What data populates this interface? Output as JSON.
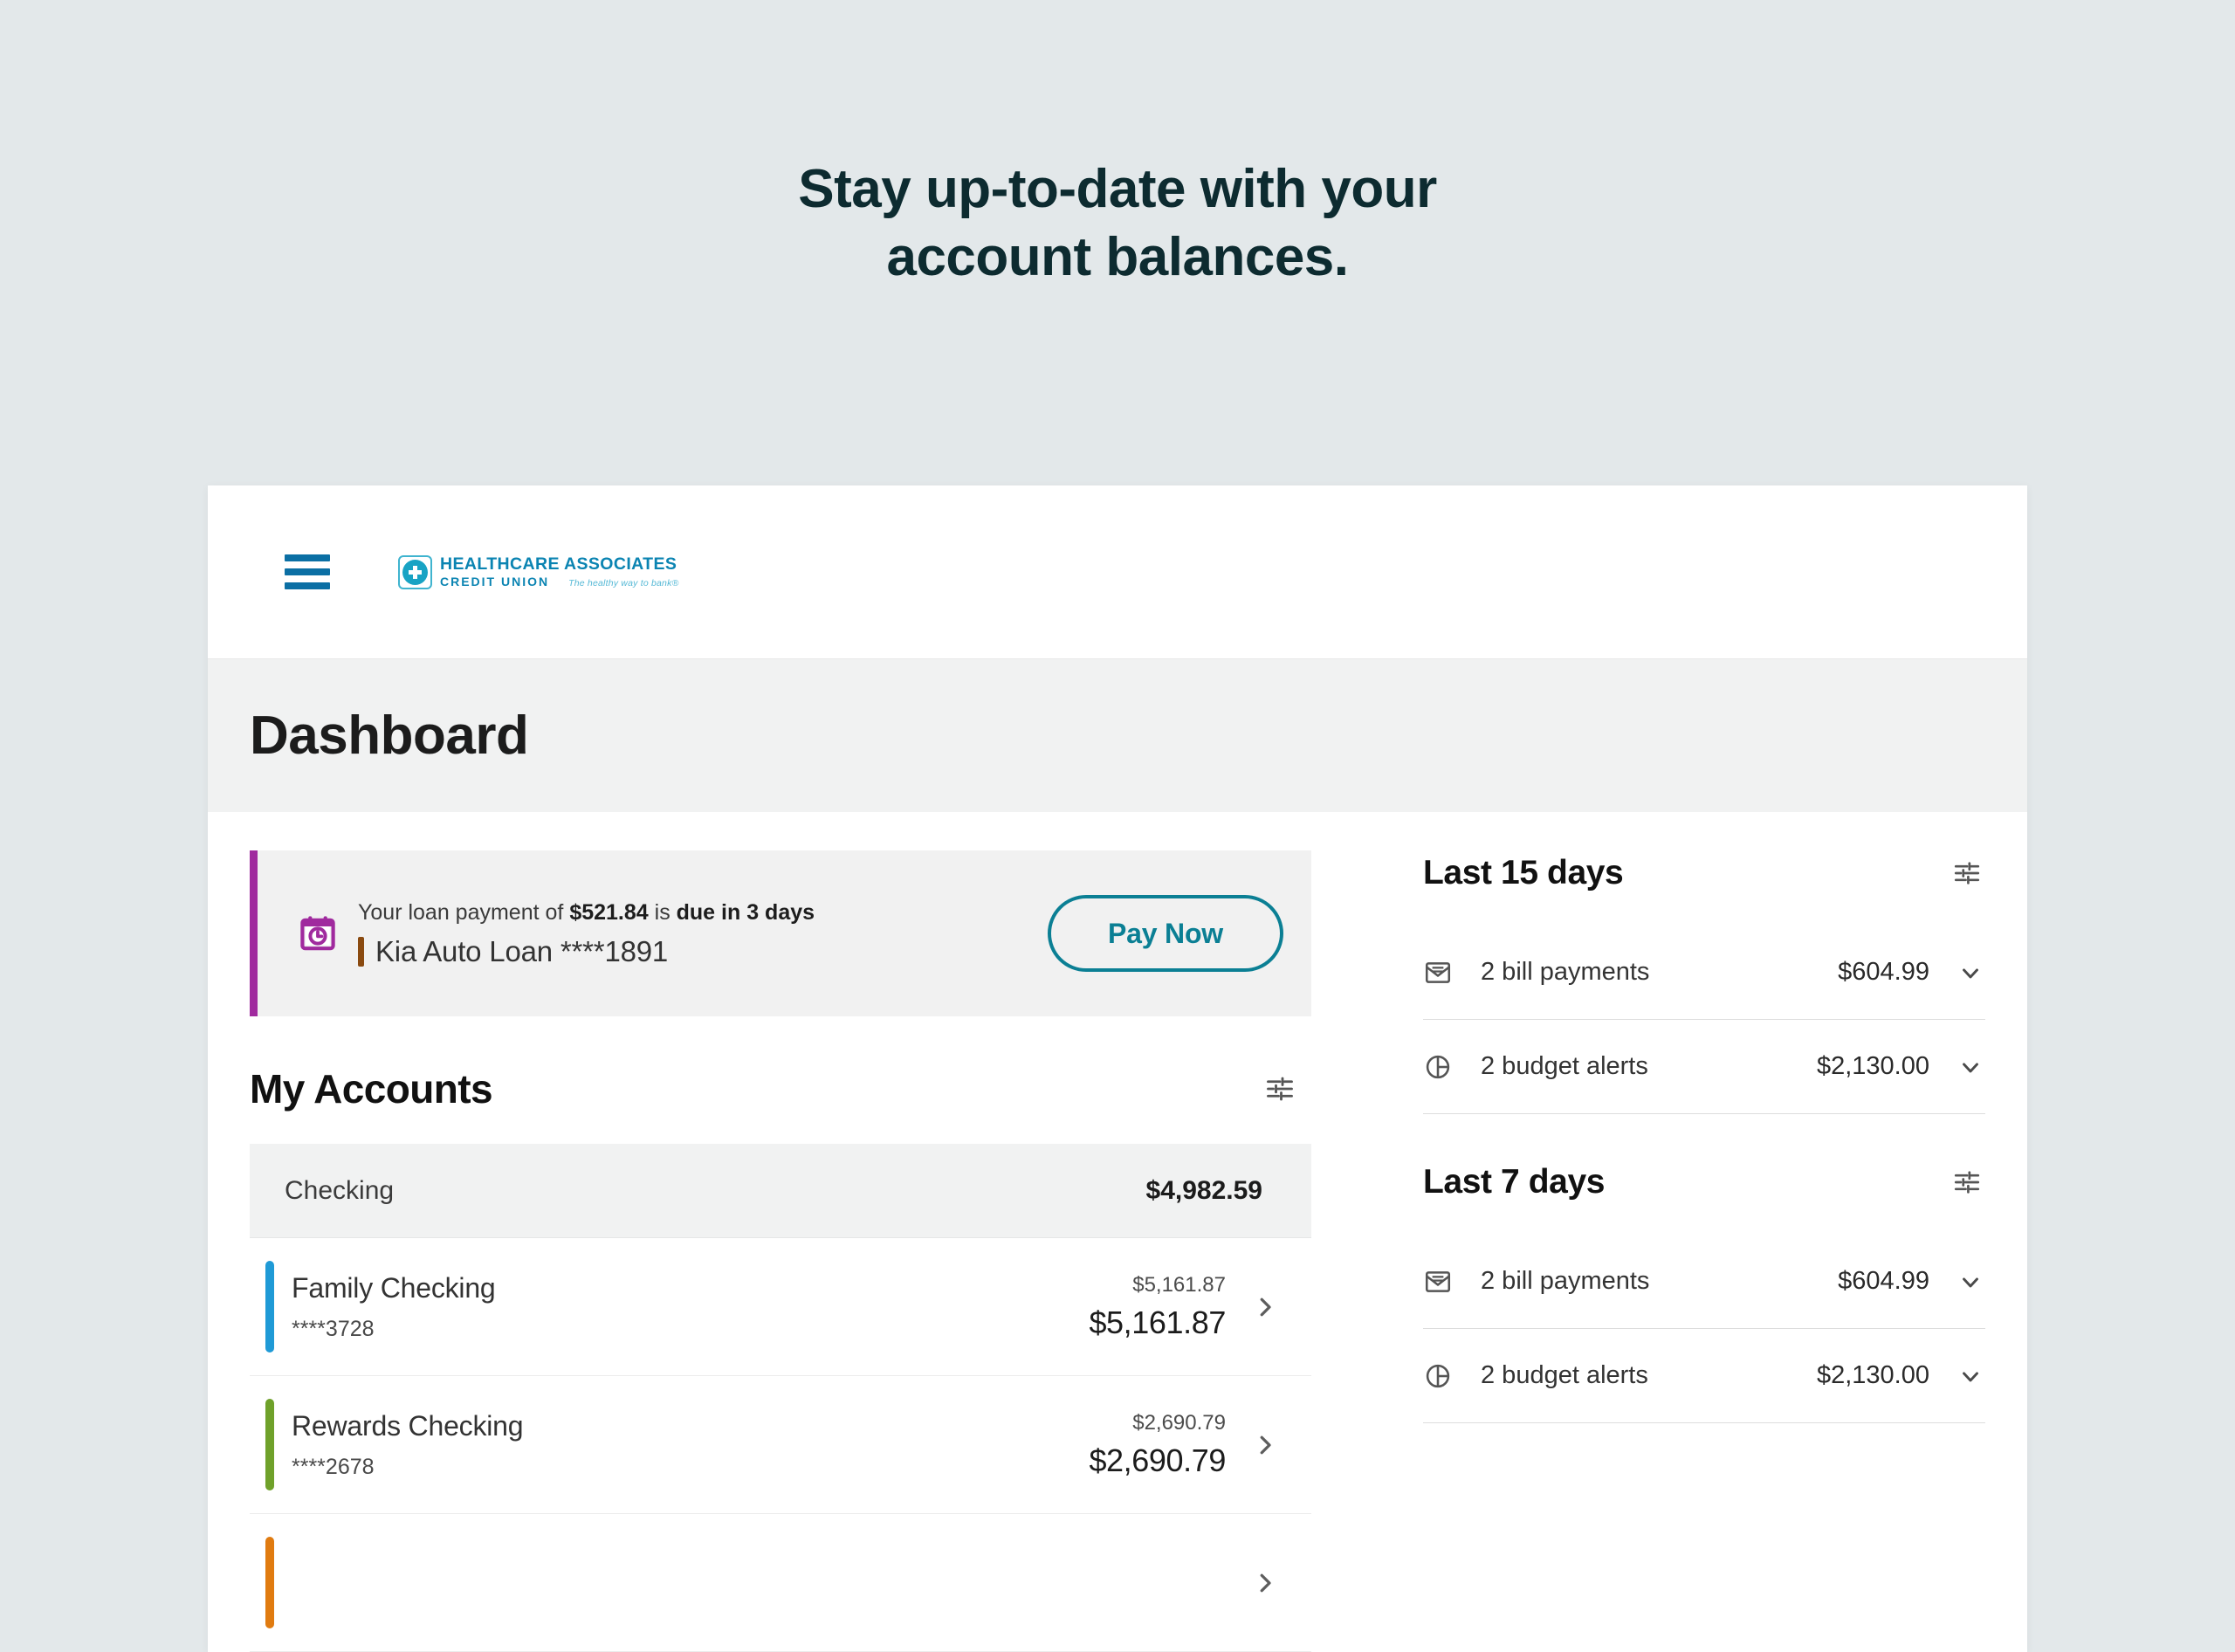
{
  "hero": {
    "line1": "Stay up-to-date with your",
    "line2": "account balances."
  },
  "colors": {
    "page_background": "#e3e8ea",
    "heading": "#0d2b30",
    "brand_blue": "#0b84b2",
    "brand_teal": "#18a3c4",
    "hamburger_blue": "#0b6fa4",
    "accent_teal": "#0b7f94",
    "alert_purple": "#a02a9e",
    "loan_brown": "#8a4a10",
    "account_blue": "#1f9ad6",
    "account_green": "#6fa12a",
    "account_orange": "#e07b10"
  },
  "topbar": {
    "menu_icon": "hamburger-menu-icon",
    "logo": {
      "mark_icon": "healthcare-cross-icon",
      "line1": "HEALTHCARE ASSOCIATES",
      "line2": "CREDIT UNION",
      "tagline": "The healthy way to bank®"
    }
  },
  "page": {
    "title": "Dashboard"
  },
  "loan_alert": {
    "icon": "calendar-clock-icon",
    "message_prefix": "Your loan payment of ",
    "amount": "$521.84",
    "message_middle": " is ",
    "due_text": "due in 3 days",
    "account_name": "Kia Auto Loan ****1891",
    "pay_button": "Pay Now",
    "accent_color": "#a02a9e",
    "account_bar_color": "#8a4a10"
  },
  "accounts_section": {
    "title": "My Accounts",
    "filter_icon": "tune-sliders-icon",
    "group": {
      "name": "Checking",
      "total": "$4,982.59"
    },
    "rows": [
      {
        "name": "Family Checking",
        "mask": "****3728",
        "available": "$5,161.87",
        "balance": "$5,161.87",
        "accent_color": "#1f9ad6",
        "chevron_icon": "chevron-right-icon"
      },
      {
        "name": "Rewards Checking",
        "mask": "****2678",
        "available": "$2,690.79",
        "balance": "$2,690.79",
        "accent_color": "#6fa12a",
        "chevron_icon": "chevron-right-icon"
      },
      {
        "name": "",
        "mask": "",
        "available": "",
        "balance": "",
        "accent_color": "#e07b10",
        "chevron_icon": "chevron-right-icon"
      }
    ]
  },
  "activity_panels": [
    {
      "title": "Last 15 days",
      "filter_icon": "tune-sliders-icon",
      "rows": [
        {
          "icon": "bill-envelope-icon",
          "label": "2 bill payments",
          "amount": "$604.99",
          "caret_icon": "chevron-down-icon"
        },
        {
          "icon": "pie-chart-icon",
          "label": "2 budget alerts",
          "amount": "$2,130.00",
          "caret_icon": "chevron-down-icon"
        }
      ]
    },
    {
      "title": "Last 7 days",
      "filter_icon": "tune-sliders-icon",
      "rows": [
        {
          "icon": "bill-envelope-icon",
          "label": "2 bill payments",
          "amount": "$604.99",
          "caret_icon": "chevron-down-icon"
        },
        {
          "icon": "pie-chart-icon",
          "label": "2 budget alerts",
          "amount": "$2,130.00",
          "caret_icon": "chevron-down-icon"
        }
      ]
    }
  ]
}
